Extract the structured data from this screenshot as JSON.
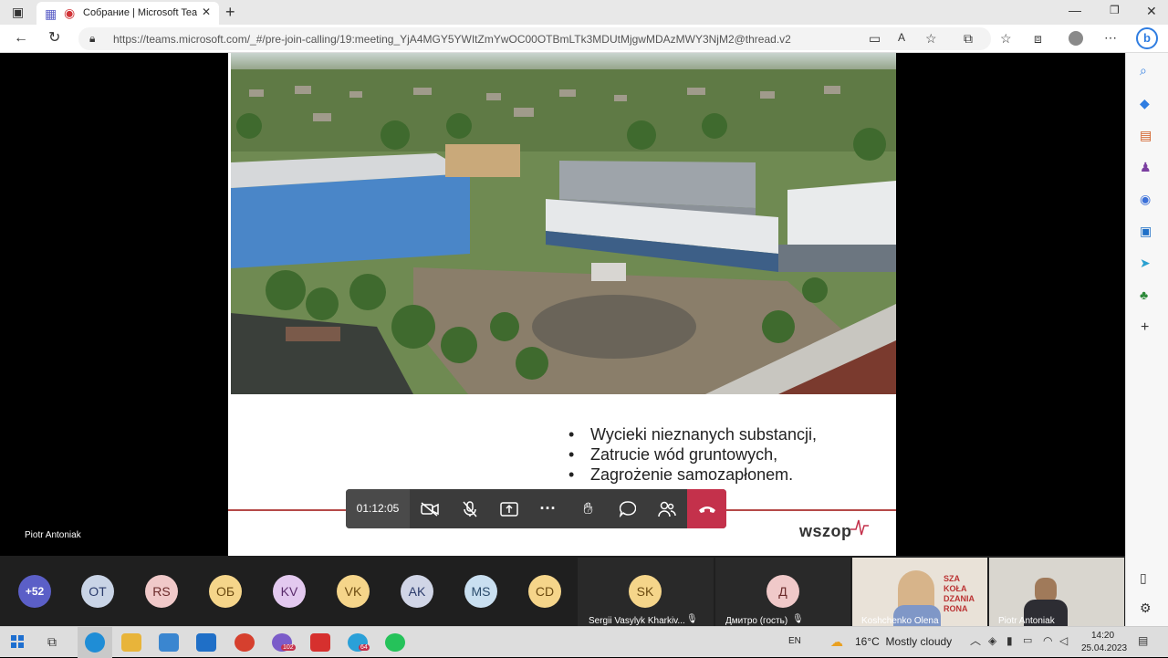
{
  "browser": {
    "tab_title": "Собрание | Microsoft Team",
    "url": "https://teams.microsoft.com/_#/pre-join-calling/19:meeting_YjA4MGY5YWItZmYwOC00OTBmLTk3MDUtMjgwMDAzMWY3NjM2@thread.v2"
  },
  "slide": {
    "bullets": [
      "Wycieki nieznanych substancji,",
      "Zatrucie wód gruntowych,",
      "Zagrożenie samozapłonem."
    ],
    "logo": "wszop"
  },
  "call": {
    "timer": "01:12:05",
    "speaker": "Piotr Antoniak"
  },
  "participants": {
    "overflow": "+52",
    "avatars": [
      {
        "initials": "OT",
        "bg": "#c9d4e6",
        "fg": "#2b3b6b"
      },
      {
        "initials": "RS",
        "bg": "#f0c9c9",
        "fg": "#6b2b2b"
      },
      {
        "initials": "ОБ",
        "bg": "#f5d58a",
        "fg": "#6b4a10"
      },
      {
        "initials": "KV",
        "bg": "#e3c9ef",
        "fg": "#5a2b6b"
      },
      {
        "initials": "VK",
        "bg": "#f5d58a",
        "fg": "#6b4a10"
      },
      {
        "initials": "AK",
        "bg": "#d0d5e6",
        "fg": "#2b3b6b"
      },
      {
        "initials": "MS",
        "bg": "#c9dff0",
        "fg": "#2b4b6b"
      },
      {
        "initials": "CD",
        "bg": "#f5d58a",
        "fg": "#6b4a10"
      }
    ],
    "tiles": [
      {
        "initials": "SK",
        "name": "Sergii Vasylyk Kharkiv..."
      },
      {
        "initials": "Д",
        "name": "Дмитро (гость)"
      }
    ],
    "video_tiles": [
      {
        "name": "Koshchenko Olena"
      },
      {
        "name": "Piotr Antoniak"
      }
    ]
  },
  "taskbar": {
    "lang": "EN",
    "weather": "16°C  Mostly cloudy",
    "time": "14:20",
    "date": "25.04.2023",
    "badges": {
      "viber": "102",
      "telegram": "64"
    }
  },
  "colors": {
    "accent": "#5b5fc7",
    "hangup": "#c4314b",
    "overflow": "#5b5fc7"
  }
}
